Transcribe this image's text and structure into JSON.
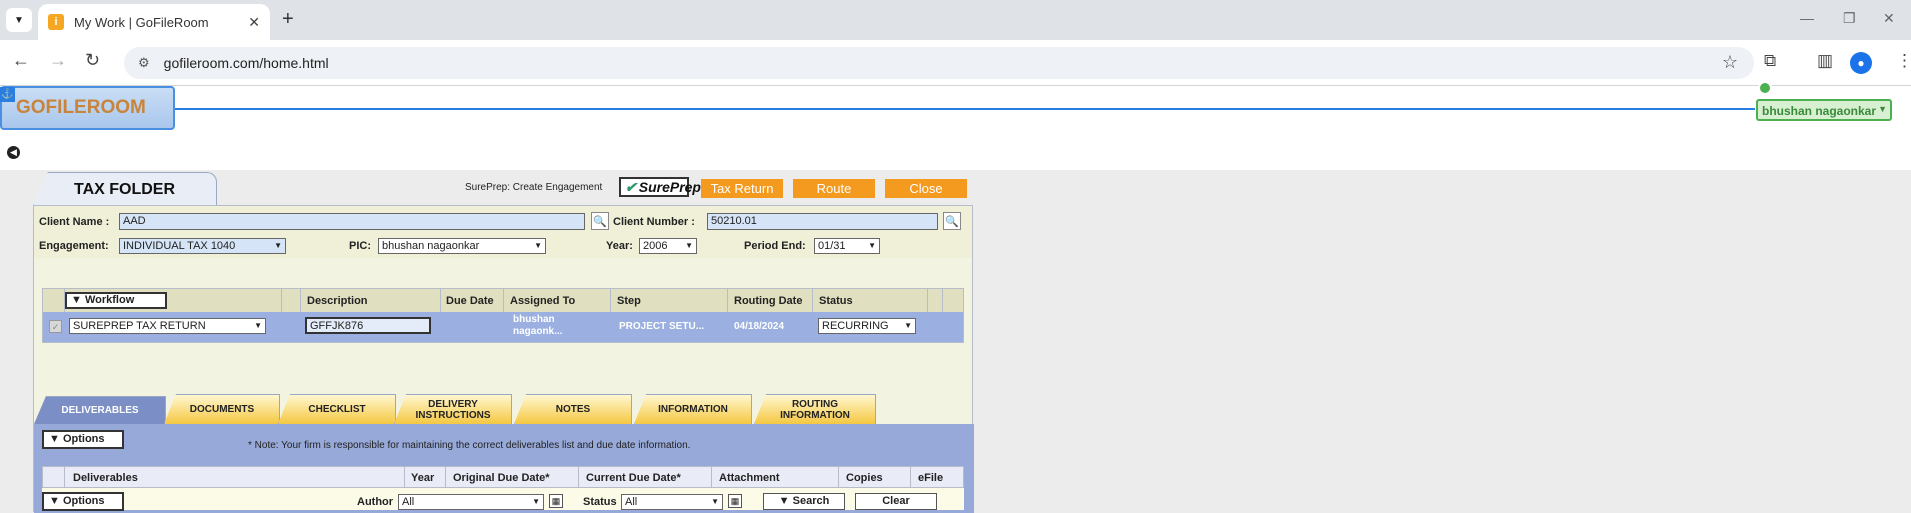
{
  "browser": {
    "tab_title": "My Work | GoFileRoom",
    "url": "gofileroom.com/home.html",
    "favicon_glyph": "i"
  },
  "header": {
    "logo": "GOFILEROOM",
    "user": "bhushan nagaonkar"
  },
  "folder": {
    "title": "TAX FOLDER",
    "sureprep_label": "SurePrep: Create Engagement",
    "sureprep_logo": "SurePrep",
    "buttons": {
      "tax_return": "Tax Return",
      "route": "Route",
      "close": "Close"
    }
  },
  "fields": {
    "client_name_label": "Client Name :",
    "client_name": "AAD",
    "client_number_label": "Client Number :",
    "client_number": "50210.01",
    "engagement_label": "Engagement:",
    "engagement": "INDIVIDUAL TAX 1040",
    "pic_label": "PIC:",
    "pic": "bhushan nagaonkar",
    "year_label": "Year:",
    "year": "2006",
    "period_end_label": "Period End:",
    "period_end": "01/31"
  },
  "workflow": {
    "button": "Workflow",
    "headers": {
      "description": "Description",
      "due_date": "Due Date",
      "assigned_to": "Assigned To",
      "step": "Step",
      "routing_date": "Routing Date",
      "status": "Status"
    },
    "row": {
      "workflow": "SUREPREP TAX RETURN",
      "description": "GFFJK876",
      "due_date": "",
      "assigned_to_line1": "bhushan",
      "assigned_to_line2": "nagaonk...",
      "step": "PROJECT SETU...",
      "routing_date": "04/18/2024",
      "status": "RECURRING"
    }
  },
  "tabs": [
    {
      "label": "DELIVERABLES",
      "active": true
    },
    {
      "label": "DOCUMENTS"
    },
    {
      "label": "CHECKLIST"
    },
    {
      "label_1": "DELIVERY",
      "label_2": "INSTRUCTIONS"
    },
    {
      "label": "NOTES"
    },
    {
      "label": "INFORMATION"
    },
    {
      "label_1": "ROUTING",
      "label_2": "INFORMATION"
    }
  ],
  "deliverables": {
    "options": "Options",
    "note": "* Note: Your firm is responsible for maintaining the correct deliverables list and due date information.",
    "headers": {
      "deliverables": "Deliverables",
      "year": "Year",
      "original_due": "Original Due Date*",
      "current_due": "Current Due Date*",
      "attachment": "Attachment",
      "copies": "Copies",
      "efile": "eFile"
    }
  },
  "documents_bar": {
    "options": "Options",
    "author_label": "Author",
    "author": "All",
    "status_label": "Status",
    "status": "All",
    "search": "Search",
    "clear": "Clear"
  }
}
